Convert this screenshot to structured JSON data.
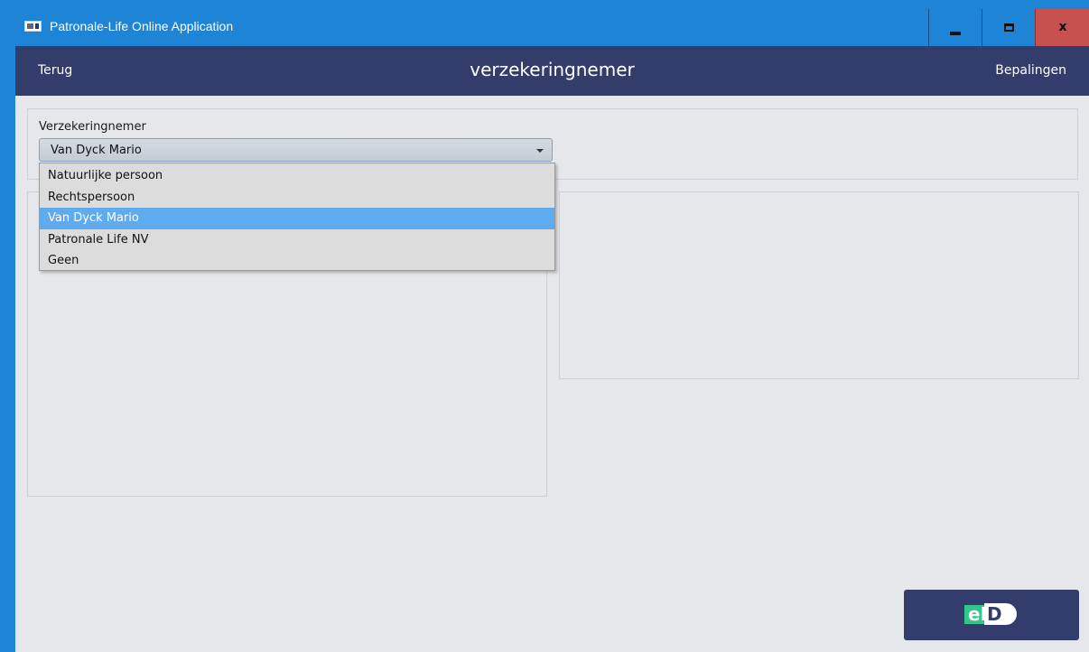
{
  "window": {
    "title": "Patronale-Life Online Application",
    "minimize_label": "",
    "maximize_label": "",
    "close_label": "x"
  },
  "header": {
    "back_label": "Terug",
    "title": "verzekeringnemer",
    "provisions_label": "Bepalingen"
  },
  "form": {
    "policyholder_label": "Verzekeringnemer",
    "policyholder_value": "Van Dyck Mario",
    "options": [
      "Natuurlijke persoon",
      "Rechtspersoon",
      "Van Dyck Mario",
      "Patronale Life NV",
      "Geen"
    ],
    "selected_index": 2
  },
  "eid": {
    "label_e": "eI",
    "label_d": "D"
  },
  "colors": {
    "titlebar": "#1e85d6",
    "header": "#333d6b",
    "close_button": "#c75050",
    "selection": "#5eabf0",
    "eid_green": "#35c58c"
  },
  "icons": {
    "app": "app-window-icon",
    "minimize": "minimize-icon",
    "maximize": "maximize-icon",
    "close": "close-icon",
    "dropdown": "chevron-down-icon"
  }
}
